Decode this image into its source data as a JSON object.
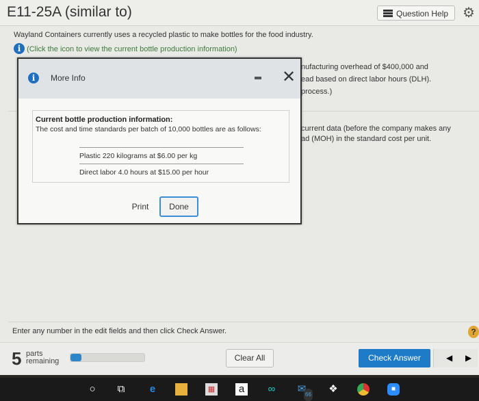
{
  "header": {
    "title": "E11-25A (similar to)",
    "question_help": "Question Help"
  },
  "question": {
    "intro": "Wayland Containers currently uses a recycled plastic to make bottles for the food industry.",
    "info_link": "(Click the icon to view the current bottle production information)",
    "partial_lines": [
      "nufacturing overhead of $400,000 and",
      "ead based on direct labor hours (DLH).",
      "process.)",
      "current data (before the company makes any",
      "ad (MOH) in the standard cost per unit."
    ]
  },
  "modal": {
    "title": "More Info",
    "heading": "Current bottle production information:",
    "text": "The cost and time standards per batch of 10,000 bottles are as follows:",
    "rows": [
      "Plastic 220 kilograms at $6.00 per kg",
      "Direct labor 4.0 hours at $15.00 per hour"
    ],
    "print": "Print",
    "done": "Done"
  },
  "instruction": "Enter any number in the edit fields and then click Check Answer.",
  "footer": {
    "parts_count": "5",
    "parts_label_1": "parts",
    "parts_label_2": "remaining",
    "progress_percent": 15,
    "clear_all": "Clear All",
    "check_answer": "Check Answer"
  },
  "taskbar": {
    "mail_badge": "66"
  },
  "colors": {
    "accent": "#1e7bc8",
    "info_link": "#3d7a3d"
  }
}
